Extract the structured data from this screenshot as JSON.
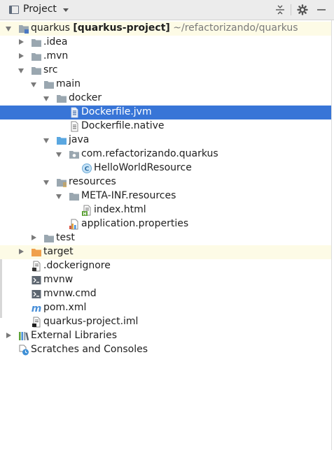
{
  "header": {
    "title": "Project",
    "buttons": [
      "collapse-all-icon",
      "gear-icon",
      "minimize-icon"
    ]
  },
  "colors": {
    "selection": "#3875d7",
    "folder": "#9aa7b0",
    "source_folder": "#5aa7e0",
    "excluded_folder": "#f0a04b",
    "highlight_row": "#fdfbe6"
  },
  "tree": {
    "root_name": "quarkus",
    "root_module": "[quarkus-project]",
    "root_path": "~/refactorizando/quarkus",
    "idea": ".idea",
    "mvn": ".mvn",
    "src": "src",
    "main": "main",
    "docker": "docker",
    "dockerfile_jvm": "Dockerfile.jvm",
    "dockerfile_native": "Dockerfile.native",
    "java": "java",
    "package": "com.refactorizando.quarkus",
    "hello_class": "HelloWorldResource",
    "resources": "resources",
    "meta_inf": "META-INF.resources",
    "index_html": "index.html",
    "app_props": "application.properties",
    "test": "test",
    "target": "target",
    "dockerignore": ".dockerignore",
    "mvnw": "mvnw",
    "mvnw_cmd": "mvnw.cmd",
    "pom": "pom.xml",
    "iml": "quarkus-project.iml",
    "external_libraries": "External Libraries",
    "scratches": "Scratches and Consoles"
  }
}
